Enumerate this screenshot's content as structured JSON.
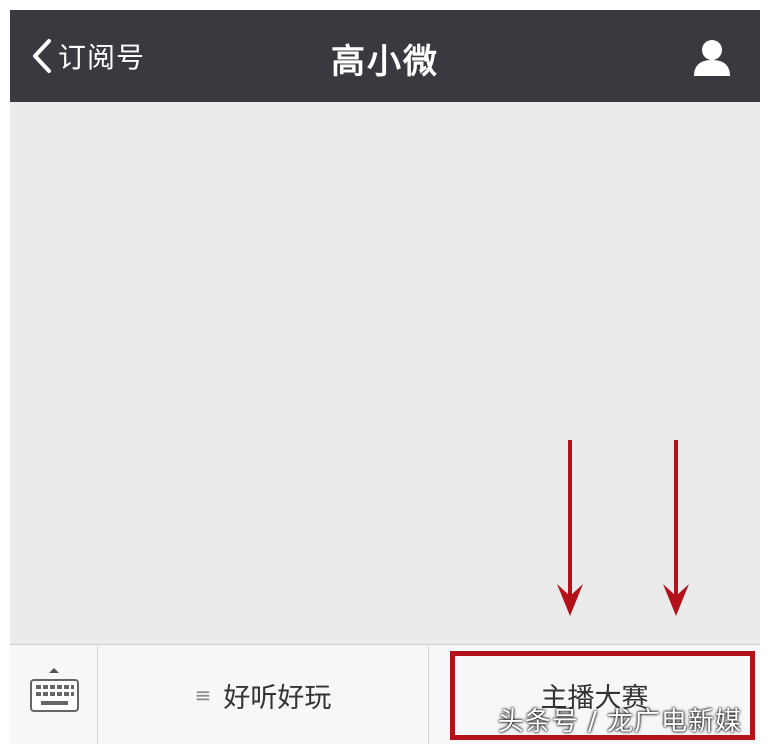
{
  "navbar": {
    "back_label": "订阅号",
    "title": "高小微",
    "background": "#393a3f"
  },
  "menu": {
    "items": [
      {
        "label": "好听好玩",
        "has_submenu": true
      },
      {
        "label": "主播大赛",
        "has_submenu": false
      }
    ]
  },
  "annotation": {
    "color": "#b3121b"
  },
  "watermark": "头条号 / 龙广电新媒"
}
